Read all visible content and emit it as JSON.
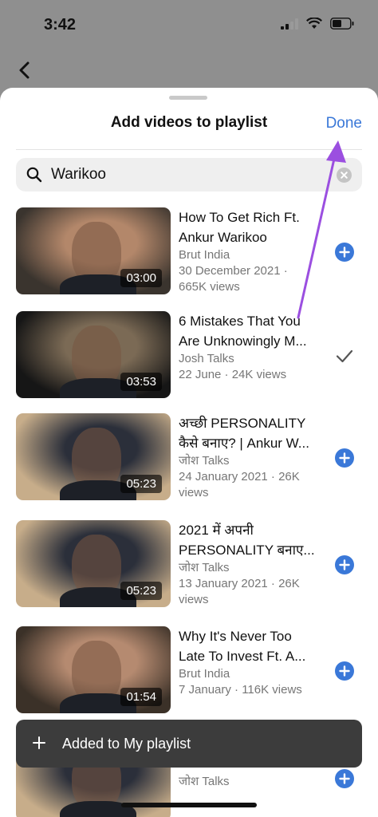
{
  "status_bar": {
    "time": "3:42"
  },
  "sheet": {
    "title": "Add videos to playlist",
    "done_label": "Done"
  },
  "search": {
    "value": "Warikoo",
    "placeholder": "Search"
  },
  "videos": [
    {
      "title_line1": "How To Get Rich Ft.",
      "title_line2": "Ankur Warikoo",
      "channel": "Brut India",
      "meta_line1": "30 December 2021 ·",
      "meta_line2": "665K views",
      "duration": "03:00",
      "action": "add",
      "thumb_colors": [
        "#3a342e",
        "#b3876a"
      ]
    },
    {
      "title_line1": "6 Mistakes That You",
      "title_line2": "Are Unknowingly M...",
      "channel": "Josh Talks",
      "meta_line1": "22 June · 24K views",
      "meta_line2": "",
      "duration": "03:53",
      "action": "added",
      "thumb_colors": [
        "#161616",
        "#7b6a55"
      ]
    },
    {
      "title_line1": "अच्छी PERSONALITY",
      "title_line2": "कैसे बनाए? | Ankur W...",
      "channel": "जोश Talks",
      "meta_line1": "24 January 2021 · 26K",
      "meta_line2": "views",
      "duration": "05:23",
      "action": "add",
      "thumb_colors": [
        "#c7ad8a",
        "#2b2f3a"
      ]
    },
    {
      "title_line1": "2021 में अपनी",
      "title_line2": "PERSONALITY बनाए...",
      "channel": "जोश Talks",
      "meta_line1": "13 January 2021 · 26K",
      "meta_line2": "views",
      "duration": "05:23",
      "action": "add",
      "thumb_colors": [
        "#c7ad8a",
        "#2b2f3a"
      ]
    },
    {
      "title_line1": "Why It's Never Too",
      "title_line2": "Late To Invest Ft. A...",
      "channel": "Brut India",
      "meta_line1": "7 January · 116K views",
      "meta_line2": "",
      "duration": "01:54",
      "action": "add",
      "thumb_colors": [
        "#3b3128",
        "#b58a70"
      ]
    },
    {
      "title_line1": "",
      "title_line2": "",
      "channel": "जोश Talks",
      "meta_line1": "",
      "meta_line2": "",
      "duration": "",
      "action": "add",
      "thumb_colors": [
        "#c7ad8a",
        "#2b2f3a"
      ]
    }
  ],
  "toast": {
    "text": "Added to My playlist"
  },
  "colors": {
    "accent": "#3a78d8",
    "annotation": "#9b4fe0"
  }
}
